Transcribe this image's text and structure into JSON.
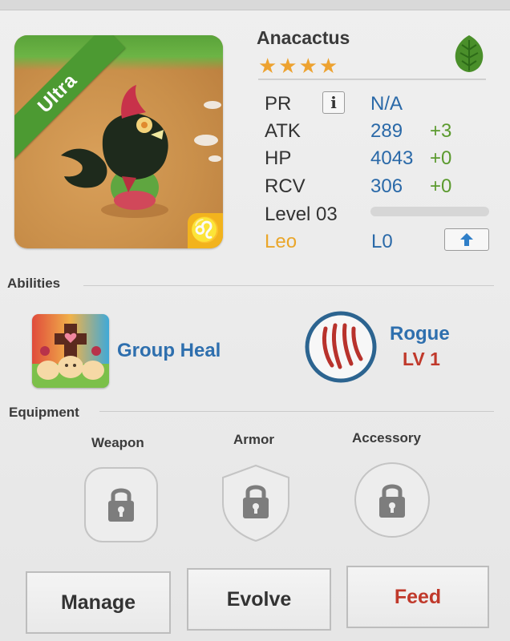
{
  "monster": {
    "name": "Anacactus",
    "stars": "★★★★",
    "rarity": "Ultra",
    "element_icon": "leaf-icon",
    "zodiac_icon": "leo-icon",
    "zodiac_glyph": "♌"
  },
  "stats": {
    "pr": {
      "label": "PR",
      "value": "N/A"
    },
    "atk": {
      "label": "ATK",
      "value": "289",
      "bonus": "+3"
    },
    "hp": {
      "label": "HP",
      "value": "4043",
      "bonus": "+0"
    },
    "rcv": {
      "label": "RCV",
      "value": "306",
      "bonus": "+0"
    },
    "level": {
      "label": "Level 03",
      "progress": 0
    },
    "zodiac": {
      "label": "Leo",
      "value": "L0"
    }
  },
  "abilities": {
    "section_title": "Abilities",
    "ability_name": "Group Heal",
    "class_name": "Rogue",
    "class_level": "LV 1"
  },
  "equipment": {
    "section_title": "Equipment",
    "slots": [
      {
        "label": "Weapon",
        "icon": "lock-icon"
      },
      {
        "label": "Armor",
        "icon": "lock-icon"
      },
      {
        "label": "Accessory",
        "icon": "lock-icon"
      }
    ]
  },
  "actions": {
    "manage": "Manage",
    "evolve": "Evolve",
    "feed": "Feed"
  },
  "colors": {
    "stat_value": "#2a69a8",
    "stat_bonus": "#5b9a2e",
    "zodiac": "#eaa62a",
    "feed": "#c0392b",
    "ultra_ribbon": "#4c9a32"
  }
}
